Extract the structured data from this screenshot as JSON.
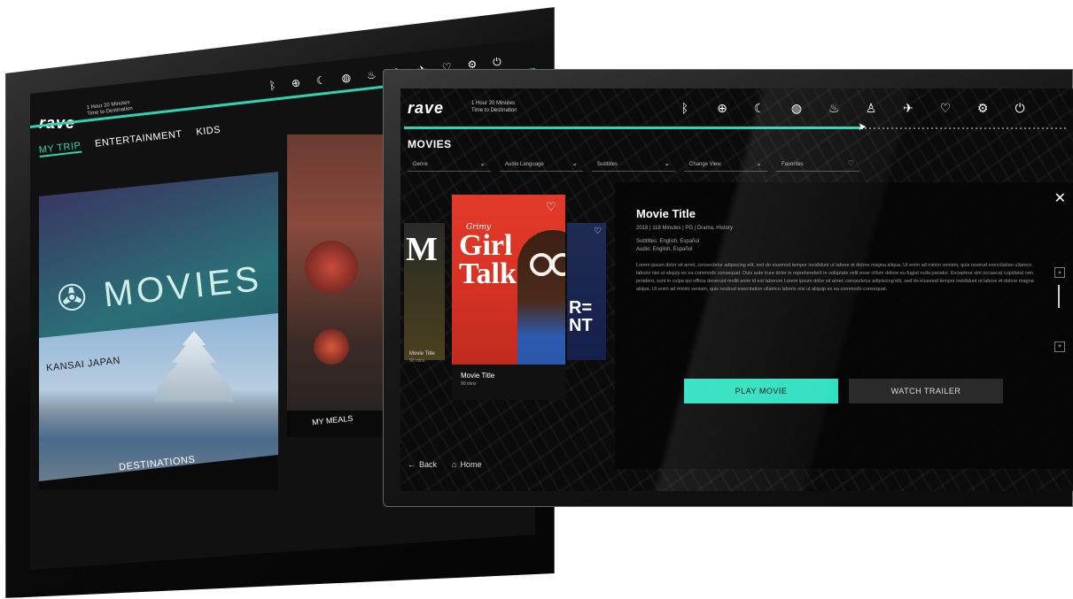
{
  "left_device": {
    "logo": "rave",
    "flight_time": "1 Hour 20 Minutes",
    "flight_sub": "Time to Destination",
    "tabs": [
      {
        "label": "MY TRIP",
        "active": true
      },
      {
        "label": "ENTERTAINMENT",
        "active": false
      },
      {
        "label": "KIDS",
        "active": false
      }
    ],
    "tiles": {
      "movies_label": "MOVIES",
      "meals_label": "MY MEALS",
      "kansai_label": "KANSAI JAPAN",
      "destinations_label": "DESTINATIONS"
    },
    "icons": [
      "bluetooth-icon",
      "globe-icon",
      "moon-icon",
      "vibration-icon",
      "drop-icon",
      "person-icon",
      "plane-icon",
      "heart-icon",
      "settings-icon",
      "power-icon"
    ]
  },
  "right_device": {
    "logo": "rave",
    "flight_time": "1 Hour 20 Minutes",
    "flight_sub": "Time to Destination",
    "progress": 0.69,
    "icons": [
      {
        "name": "bluetooth-icon",
        "glyph": "ᛒ"
      },
      {
        "name": "globe-icon",
        "glyph": "⊕"
      },
      {
        "name": "moon-icon",
        "glyph": "☾"
      },
      {
        "name": "vibration-icon",
        "glyph": "◍"
      },
      {
        "name": "drop-icon",
        "glyph": "♨"
      },
      {
        "name": "accessibility-icon",
        "glyph": "♙"
      },
      {
        "name": "plane-icon",
        "glyph": "✈"
      },
      {
        "name": "heart-icon",
        "glyph": "♡"
      },
      {
        "name": "settings-icon",
        "glyph": "⚙"
      },
      {
        "name": "power-icon",
        "glyph": "⏻"
      }
    ],
    "section_title": "MOVIES",
    "filters": [
      {
        "label": "Genre"
      },
      {
        "label": "Audio Language"
      },
      {
        "label": "Subtitles"
      },
      {
        "label": "Change View"
      },
      {
        "label": "Favorites"
      }
    ],
    "poster_left": {
      "big": "M",
      "title": "Movie Title",
      "sub": "90 mins"
    },
    "poster_main": {
      "script": "Grimy",
      "title_line1": "Girl",
      "title_line2": "Talk",
      "caption_title": "Movie Title",
      "caption_sub": "90 mins"
    },
    "poster_right": {
      "big": "R=\nNT"
    },
    "detail": {
      "title": "Movie Title",
      "meta": "2018 | 118 Minutes | PG | Drama, History",
      "subtitles": "Subtitles: English, Español",
      "audio": "Audio: English, Español",
      "description": "Lorem ipsum dolor sit amet, consectetur adipiscing elit, sed do eiusmod tempor incididunt ut labore et dolore magna aliqua. Ut enim ad minim veniam, quis nostrud exercitation ullamco laboris nisi ut aliquip ex ea commodo consequat. Duis aute irure dolor in reprehenderit in voluptate velit esse cillum dolore eu fugiat nulla pariatur. Excepteur sint occaecat cupidatat non proident, sunt in culpa qui officia deserunt mollit anim id est laborum Lorem ipsum dolor sit amet, consectetur adipiscing elit, sed do eiusmod tempor incididunt ut labore et dolore magna aliqua. Ut enim ad minim veniam, quis nostrud exercitation ullamco laboris nisi ut aliquip ex ea commodo consequat.",
      "play_label": "PLAY MOVIE",
      "trailer_label": "WATCH TRAILER"
    },
    "nav": {
      "back": "Back",
      "home": "Home"
    }
  },
  "colors": {
    "accent": "#2fe0c0",
    "background": "#0b0b0b"
  }
}
